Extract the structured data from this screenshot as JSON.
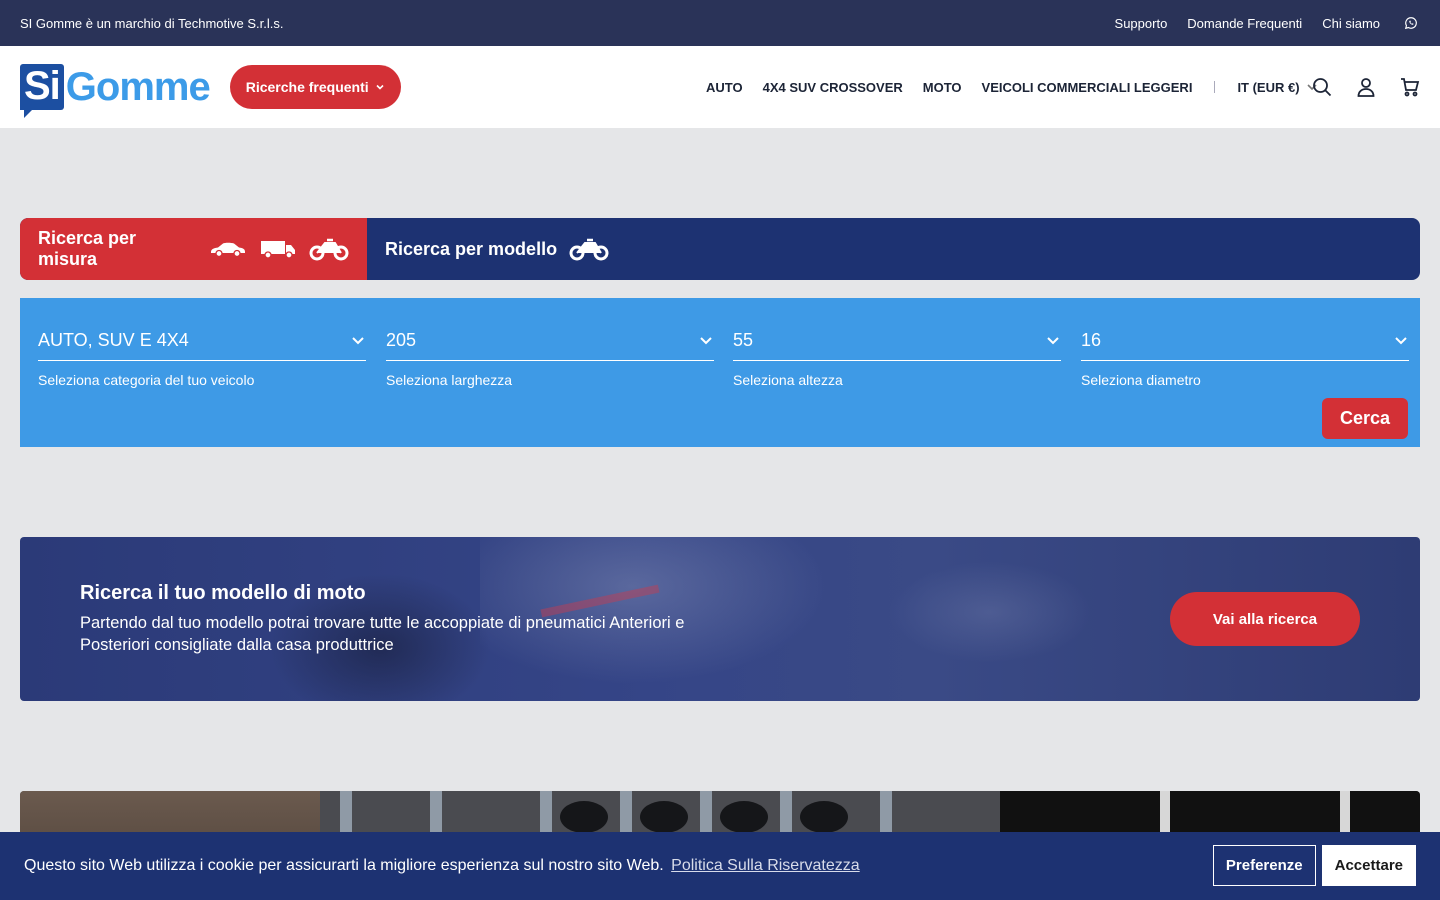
{
  "topbar": {
    "tagline": "SI Gomme è un marchio di Techmotive S.r.l.s.",
    "links": [
      "Supporto",
      "Domande Frequenti",
      "Chi siamo"
    ],
    "whatsapp_icon": "whatsapp-icon"
  },
  "header": {
    "logo_si": "Si",
    "logo_gomme": "Gomme",
    "frequent_button": "Ricerche frequenti",
    "nav": [
      "AUTO",
      "4X4 SUV CROSSOVER",
      "MOTO",
      "VEICOLI COMMERCIALI LEGGERI"
    ],
    "language": "IT (EUR €)",
    "icons": [
      "search-icon",
      "account-icon",
      "cart-icon"
    ]
  },
  "search_tabs": {
    "by_size": "Ricerca per misura",
    "by_model": "Ricerca per modello"
  },
  "search": {
    "fields": [
      {
        "value": "AUTO, SUV E 4X4",
        "help": "Seleziona categoria del tuo veicolo"
      },
      {
        "value": "205",
        "help": "Seleziona larghezza"
      },
      {
        "value": "55",
        "help": "Seleziona altezza"
      },
      {
        "value": "16",
        "help": "Seleziona diametro"
      }
    ],
    "button": "Cerca"
  },
  "moto_banner": {
    "title": "Ricerca il tuo modello di moto",
    "text": "Partendo dal tuo modello potrai trovare tutte le accoppiate di pneumatici Anteriori e Posteriori consigliate dalla casa produttrice",
    "button": "Vai alla ricerca"
  },
  "cookie": {
    "text": "Questo sito Web utilizza i cookie per assicurarti la migliore esperienza sul nostro sito Web.",
    "link": "Politica Sulla Riservatezza",
    "preferences": "Preferenze",
    "accept": "Accettare"
  },
  "colors": {
    "navy": "#1d3272",
    "topbar": "#2a3358",
    "red": "#d33036",
    "blue": "#3e9ae6"
  }
}
